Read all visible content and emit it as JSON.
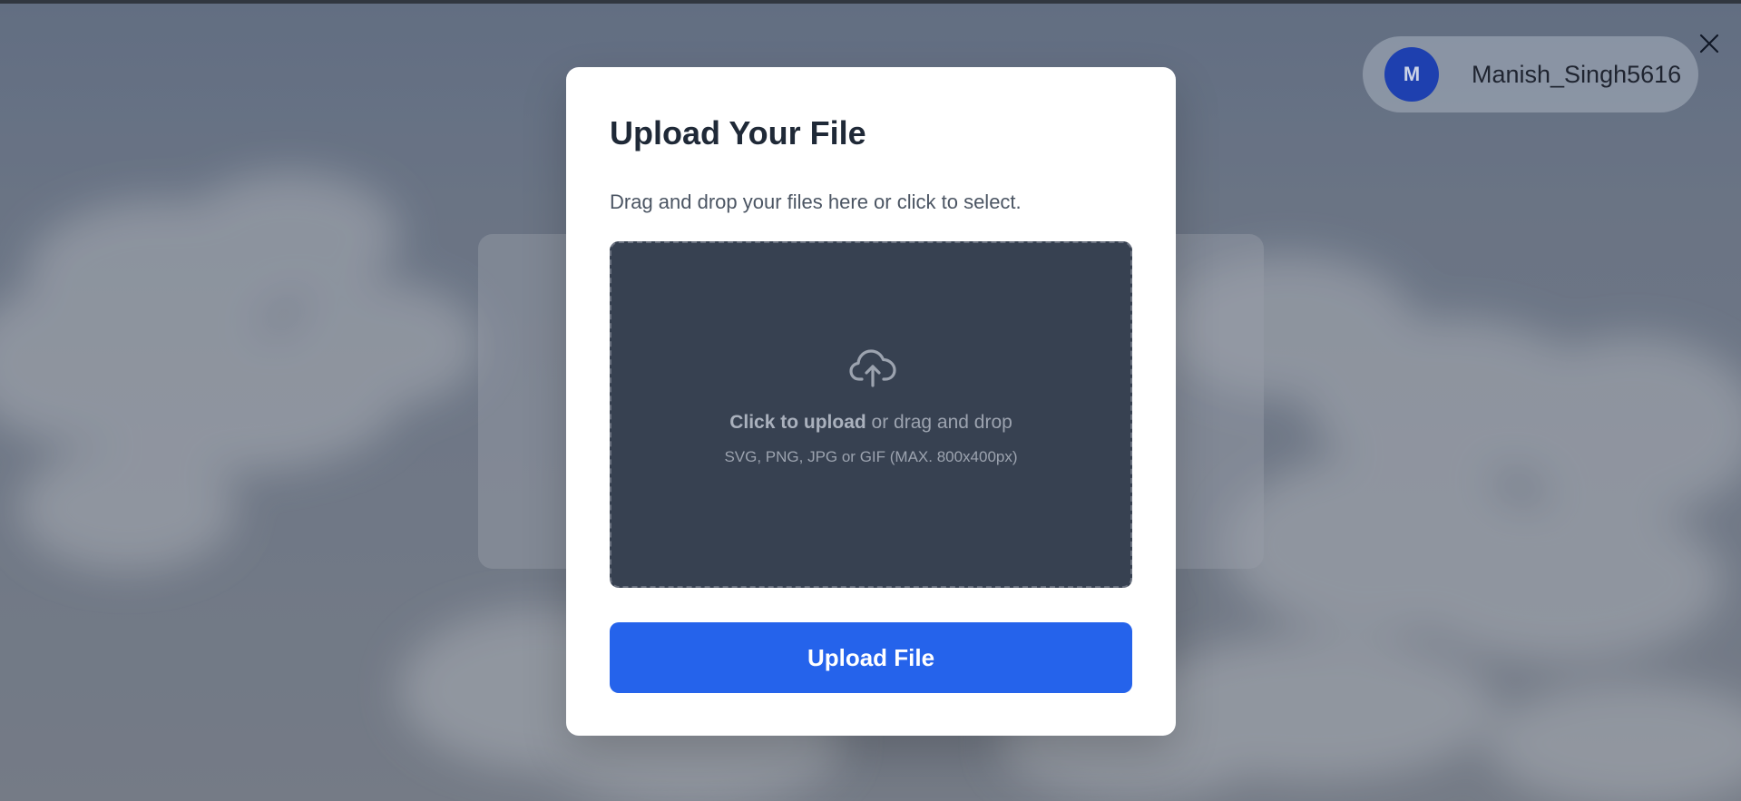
{
  "user": {
    "avatar_initial": "M",
    "username": "Manish_Singh5616"
  },
  "modal": {
    "title": "Upload Your File",
    "description": "Drag and drop your files here or click to select.",
    "dropzone": {
      "primary_strong": "Click to upload",
      "primary_rest": " or drag and drop",
      "hint": "SVG, PNG, JPG or GIF (MAX. 800x400px)",
      "icon": "cloud-upload-icon"
    },
    "upload_button_label": "Upload File"
  },
  "icons": {
    "close": "close-icon",
    "upload": "cloud-upload-icon"
  },
  "colors": {
    "primary": "#2563eb",
    "avatar_bg": "#1e40af",
    "dropzone_bg": "#374151",
    "title_text": "#1f2937"
  }
}
